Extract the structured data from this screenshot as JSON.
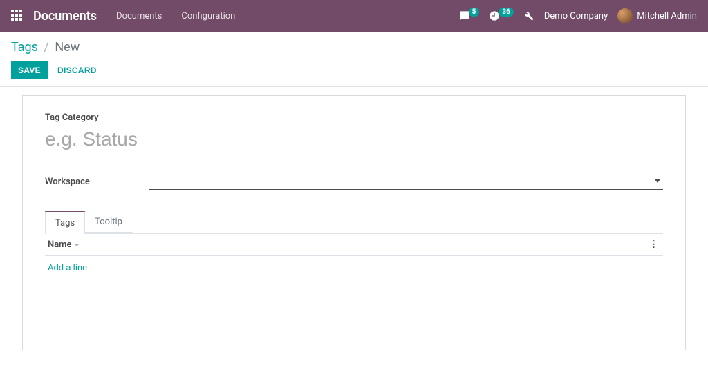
{
  "navbar": {
    "app_title": "Documents",
    "menu": [
      "Documents",
      "Configuration"
    ],
    "messages_count": "5",
    "activities_count": "36",
    "company": "Demo Company",
    "user": "Mitchell Admin"
  },
  "breadcrumb": {
    "root": "Tags",
    "current": "New"
  },
  "buttons": {
    "save": "Save",
    "discard": "Discard"
  },
  "form": {
    "tag_category_label": "Tag Category",
    "tag_category_placeholder": "e.g. Status",
    "tag_category_value": "",
    "workspace_label": "Workspace",
    "workspace_value": ""
  },
  "notebook": {
    "tabs": [
      "Tags",
      "Tooltip"
    ],
    "active_tab": 0,
    "list": {
      "columns": [
        "Name"
      ],
      "rows": [],
      "add_line": "Add a line"
    }
  }
}
